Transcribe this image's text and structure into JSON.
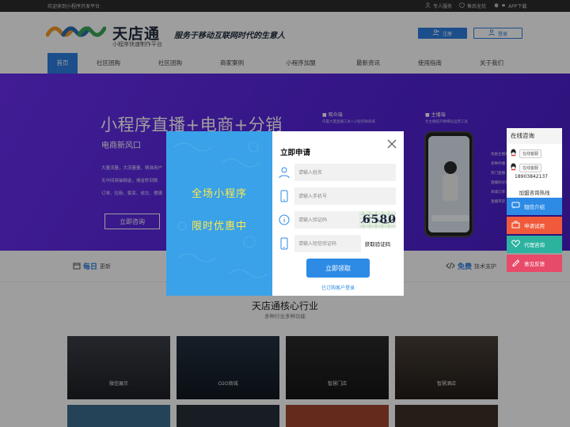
{
  "topbar": {
    "welcome": "欢迎来到小程序开发平台",
    "links": [
      "专人服务",
      "售后无忧",
      "APP下载"
    ]
  },
  "header": {
    "brand": "天店通",
    "brand_sub": "小程序快速制作平台",
    "slogan": "服务于移动互联网时代的生意人",
    "register_label": "注册",
    "login_label": "登录"
  },
  "nav": {
    "items": [
      "首页",
      "社区团购",
      "社区团购",
      "商家案例",
      "小程序加盟",
      "最新资讯",
      "使用指南",
      "关于我们"
    ],
    "active_index": 0
  },
  "hero": {
    "title": "小程序直播+电商+分销",
    "subtitle": "电商新风口",
    "bullets": [
      "大量流量，大流量量、精准用户",
      "无中间商抽佣金，佣金秒到账",
      "订单、拉新、裂变、成交、便捷"
    ],
    "consult_label": "立即咨询",
    "features": [
      {
        "title": "■ 观众端",
        "desc": "内置大量直播工具+小程序微商城"
      },
      {
        "title": "■ 主播端",
        "desc": "为主播提升精细化运营工具"
      }
    ],
    "phone_features": [
      "优质主播来",
      "多种开播",
      "热门直播",
      "直播间分享",
      "商城订单",
      "直播带货"
    ]
  },
  "strip": {
    "items": [
      {
        "bold": "每日",
        "text": "更新"
      },
      {
        "bold": "免费",
        "text": "技术支护"
      }
    ]
  },
  "section": {
    "title": "天店通核心行业",
    "subtitle": "多种行业多种功能"
  },
  "tiles": [
    {
      "label": "微信展示"
    },
    {
      "label": "O2O商城"
    },
    {
      "label": "智慧门店"
    },
    {
      "label": "智慧酒店"
    }
  ],
  "side_panel": {
    "title": "在线咨询",
    "qq_buttons": [
      "在线客服",
      "在线客服"
    ],
    "hotline_label": "加盟咨询热线",
    "hotline_number": "18903842137",
    "buttons": [
      {
        "label": "短信介绍",
        "color": "#2d8be6"
      },
      {
        "label": "申请试用",
        "color": "#f05a3a"
      },
      {
        "label": "代理咨询",
        "color": "#2bb3a0"
      },
      {
        "label": "意见反馈",
        "color": "#e84a6a"
      }
    ]
  },
  "modal": {
    "promo_line1": "全场小程序",
    "promo_line2": "限时优惠中",
    "title": "立即申请",
    "name_placeholder": "请输入姓名",
    "phone_placeholder": "请输入手机号",
    "code_placeholder": "请输入验证码",
    "captcha_text": "6580",
    "sms_placeholder": "请输入短信验证码",
    "sms_button": "获取验证码",
    "submit_label": "立即领取",
    "link_label": "已订购客户登录"
  },
  "colors": {
    "primary": "#2d7fe0",
    "hero_purple": "#5a28e0",
    "promo_yellow": "#ffe94a",
    "modal_blue": "#3aa2e8"
  }
}
